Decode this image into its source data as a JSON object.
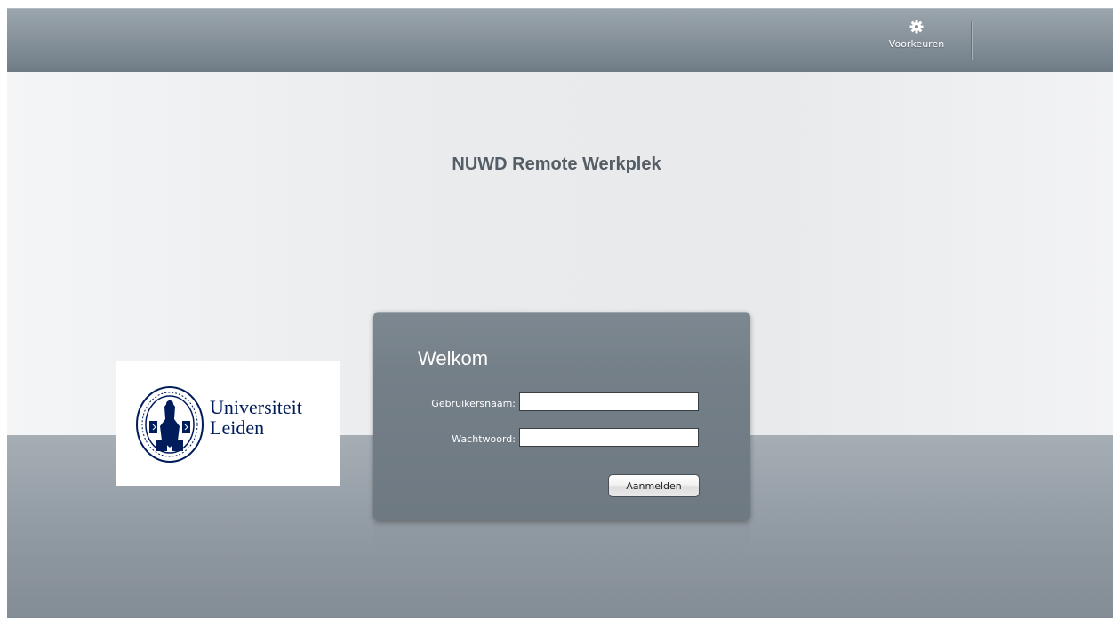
{
  "toolbar": {
    "preferences_label": "Voorkeuren",
    "preferences_icon": "gear-icon"
  },
  "page": {
    "title": "NUWD Remote Werkplek"
  },
  "logo": {
    "line1": "Universiteit",
    "line2": "Leiden",
    "color": "#001c5a"
  },
  "login": {
    "heading": "Welkom",
    "username_label": "Gebruikersnaam:",
    "username_value": "",
    "password_label": "Wachtwoord:",
    "password_value": "",
    "submit_label": "Aanmelden"
  }
}
